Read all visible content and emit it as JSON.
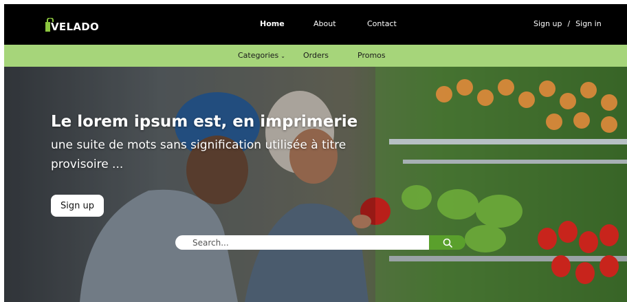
{
  "brand": {
    "name": "VELADO"
  },
  "nav": {
    "home": "Home",
    "about": "About",
    "contact": "Contact",
    "signup": "Sign up",
    "separator": "/",
    "signin": "Sign in"
  },
  "subnav": {
    "categories": "Categories",
    "categories_caret": "⌄",
    "orders": "Orders",
    "promos": "Promos"
  },
  "hero": {
    "title": "Le lorem ipsum est, en imprimerie",
    "subtitle": "une suite de mots sans signification utilisée à titre provisoire ...",
    "button": "Sign up"
  },
  "search": {
    "placeholder": "Search..."
  },
  "colors": {
    "topbar": "#000000",
    "subbar": "#a6d57a",
    "accent": "#5aa02c",
    "logo_bag": "#8cc63f"
  },
  "icons": {
    "logo": "shopping-bag-icon",
    "search": "search-icon",
    "dropdown": "chevron-down-icon"
  }
}
